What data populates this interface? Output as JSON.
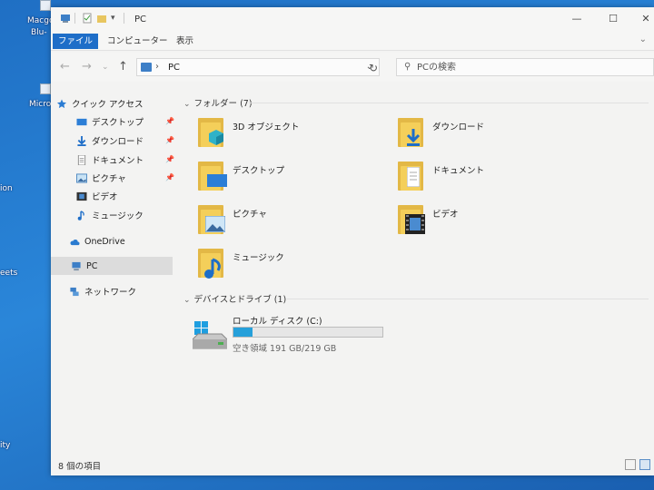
{
  "desktop": {
    "labels": [
      "Macgo",
      "Blu-",
      "Micro",
      "ion",
      "eets",
      "ity"
    ]
  },
  "window": {
    "title": "PC",
    "ribbon_tabs": [
      "ファイル",
      "コンピューター",
      "表示"
    ]
  },
  "address": {
    "crumb": "PC"
  },
  "search": {
    "placeholder": "PCの検索"
  },
  "nav": {
    "quick_access": "クイック アクセス",
    "quick_items": [
      {
        "label": "デスクトップ",
        "icon": "desktop-icon",
        "pinned": true
      },
      {
        "label": "ダウンロード",
        "icon": "download-icon",
        "pinned": true
      },
      {
        "label": "ドキュメント",
        "icon": "document-icon",
        "pinned": true
      },
      {
        "label": "ピクチャ",
        "icon": "picture-icon",
        "pinned": true
      },
      {
        "label": "ビデオ",
        "icon": "video-icon",
        "pinned": false
      },
      {
        "label": "ミュージック",
        "icon": "music-icon",
        "pinned": false
      }
    ],
    "onedrive": "OneDrive",
    "pc": "PC",
    "network": "ネットワーク"
  },
  "content": {
    "folders_header": "フォルダー (7)",
    "folders": [
      {
        "name": "3D オブジェクト",
        "icon": "3d-objects-folder-icon"
      },
      {
        "name": "ダウンロード",
        "icon": "downloads-folder-icon"
      },
      {
        "name": "デスクトップ",
        "icon": "desktop-folder-icon"
      },
      {
        "name": "ドキュメント",
        "icon": "documents-folder-icon"
      },
      {
        "name": "ピクチャ",
        "icon": "pictures-folder-icon"
      },
      {
        "name": "ビデオ",
        "icon": "videos-folder-icon"
      },
      {
        "name": "ミュージック",
        "icon": "music-folder-icon"
      }
    ],
    "devices_header": "デバイスとドライブ (1)",
    "drive": {
      "name": "ローカル ディスク (C:)",
      "free": "空き領域 191 GB/219 GB",
      "used_fraction": 0.128
    }
  },
  "status": {
    "count": "8 個の項目"
  },
  "colors": {
    "accent": "#1e6ec8",
    "drive_bar": "#26a0da",
    "folder": "#f4cf5a"
  }
}
